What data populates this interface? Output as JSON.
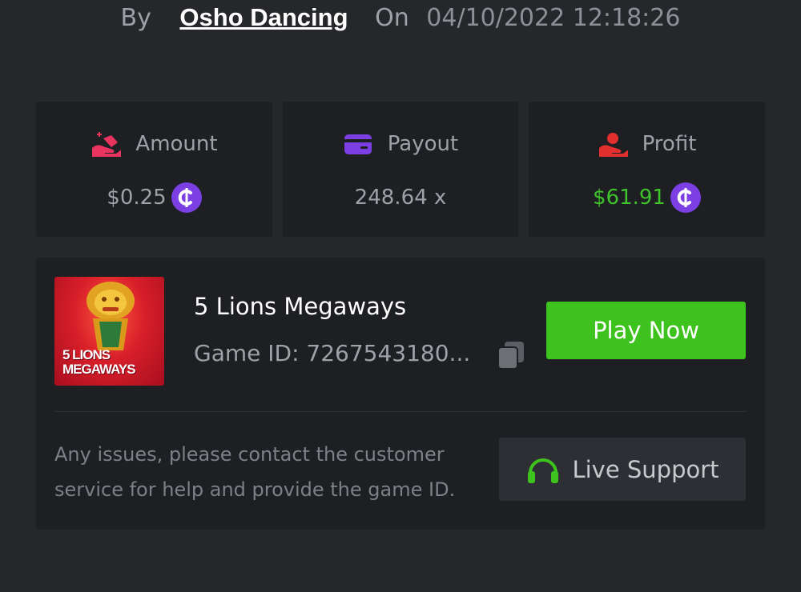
{
  "byline": {
    "by_label": "By",
    "user": "Osho Dancing",
    "on_label": "On",
    "datetime": "04/10/2022 12:18:26"
  },
  "stats": {
    "amount": {
      "label": "Amount",
      "value": "$0.25",
      "icon": "hand-coin-icon",
      "color": "#e8345f"
    },
    "payout": {
      "label": "Payout",
      "value": "248.64 x",
      "icon": "card-icon",
      "color": "#7b3fe4"
    },
    "profit": {
      "label": "Profit",
      "value": "$61.91",
      "icon": "hand-money-icon",
      "color": "#e2302f",
      "value_color": "#3ec32b"
    }
  },
  "game": {
    "thumb_line1": "5 LIONS",
    "thumb_line2": "MEGAWAYS",
    "name": "5 Lions Megaways",
    "id_text": "Game ID: 7267543180...",
    "play_label": "Play Now",
    "notice": "Any issues, please contact the customer service for help and provide the game ID.",
    "support_label": "Live Support"
  },
  "colors": {
    "background": "#26272b",
    "panel": "#1e1f23",
    "accent_green": "#3ec31e",
    "coin_purple": "#7b3fe4"
  }
}
